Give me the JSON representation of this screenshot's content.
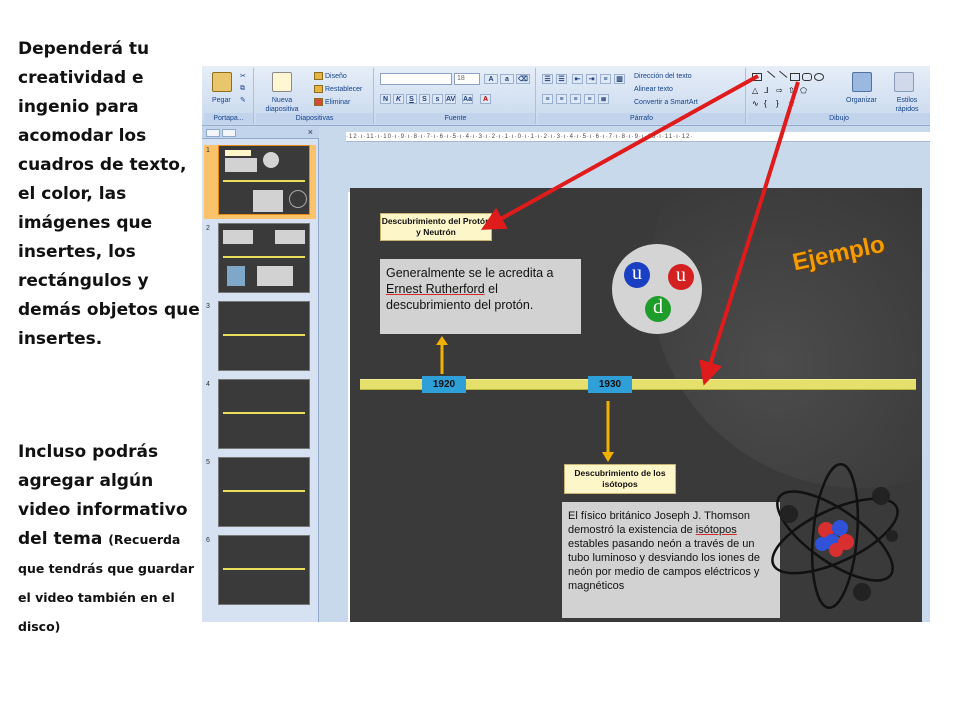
{
  "instructions": {
    "block1": "Dependerá tu creatividad e ingenio para acomodar los cuadros de texto, el color, las imágenes que insertes, los rectángulos y demás objetos que insertes.",
    "block2_main": "Incluso podrás agregar algún video informativo del tema",
    "block2_note": "(Recuerda que tendrás que guardar el video también en el disco)"
  },
  "ribbon": {
    "groups": {
      "portapapeles": "Portapa...",
      "diapositivas": "Diapositivas",
      "fuente": "Fuente",
      "parrafo": "Párrafo",
      "dibujo": "Dibujo"
    },
    "pegar": "Pegar",
    "nueva_diapositiva": "Nueva diapositiva",
    "diseno": "Diseño",
    "restablecer": "Restablecer",
    "eliminar": "Eliminar",
    "font_size": "18",
    "direccion_texto": "Dirección del texto",
    "alinear_texto": "Alinear texto",
    "convertir_smartart": "Convertir a SmartArt",
    "organizar": "Organizar",
    "estilos_rapidos": "Estilos rápidos"
  },
  "thumbnails": [
    {
      "num": "1",
      "selected": true
    },
    {
      "num": "2",
      "selected": false
    },
    {
      "num": "3",
      "selected": false
    },
    {
      "num": "4",
      "selected": false
    },
    {
      "num": "5",
      "selected": false
    },
    {
      "num": "6",
      "selected": false
    }
  ],
  "ruler": {
    "text": "·12·ı·11·ı·10·ı·9·ı·8·ı·7·ı·6·ı·5·ı·4·ı·3·ı·2·ı·1·ı·0·ı·1·ı·2·ı·3·ı·4·ı·5·ı·6·ı·7·ı·8·ı·9·ı·10·ı·11·ı·12·"
  },
  "slide": {
    "title_box_1": "Descubrimiento del Protón y Neutrón",
    "body_1_prefix": "Generalmente se le acredita a",
    "body_1_link": "Ernest Rutherford",
    "body_1_suffix": "el descubrimiento del protón.",
    "year_1": "1920",
    "year_2": "1930",
    "title_box_2": "Descubrimiento de los isótopos",
    "body_2_prefix": "El físico británico Joseph J. Thomson demostró la existencia de",
    "body_2_link": "isótopos",
    "body_2_suffix": "estables pasando neón a través de un tubo luminoso y desviando los iones de neón por medio de campos eléctricos y magnéticos",
    "ejemplo": "Ejemplo",
    "quarks": {
      "u1": "u",
      "u2": "u",
      "d": "d"
    }
  },
  "colors": {
    "arrow": "#e01b1b",
    "timeline": "#e5e06b",
    "year_box": "#2f9fd8",
    "ejemplo": "#f59d00",
    "connector": "#f0b100"
  }
}
